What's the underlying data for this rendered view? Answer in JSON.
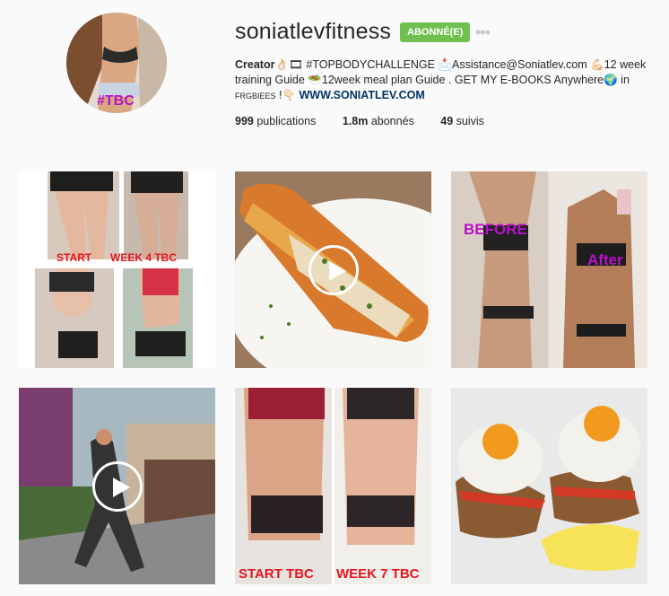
{
  "profile": {
    "username": "soniatlevfitness",
    "follow_label": "ABONNÉ(E)",
    "more_label": "•••",
    "avatar_tag": "#TBC",
    "bio": {
      "name": "Creator",
      "part1": "👌🏻🎞 #TOPBODYCHALLENGE 📩Assistance@Soniatlev.com 💪🏻12 week training Guide 🥗12week meal plan Guide . GET MY E-BOOKS Anywhere🌍 in ",
      "small": "FRGBIEES",
      "part2": " !👇🏻 ",
      "link": "WWW.SONIATLEV.COM"
    },
    "stats": {
      "posts_count": "999",
      "posts_label": "publications",
      "followers_count": "1.8m",
      "followers_label": "abonnés",
      "following_count": "49",
      "following_label": "suivis"
    }
  },
  "posts": [
    {
      "labels": [
        "START",
        "WEEK 4 TBC"
      ]
    },
    {
      "is_video": true
    },
    {
      "labels": [
        "BEFORE",
        "After"
      ]
    },
    {
      "is_video": true
    },
    {
      "labels": [
        "START TBC",
        "WEEK 7 TBC"
      ]
    },
    {
      "is_video": false
    }
  ],
  "colors": {
    "follow_green": "#70c050",
    "link_blue": "#003569",
    "caption_red": "#e8141c",
    "caption_purple": "#b812c8"
  }
}
